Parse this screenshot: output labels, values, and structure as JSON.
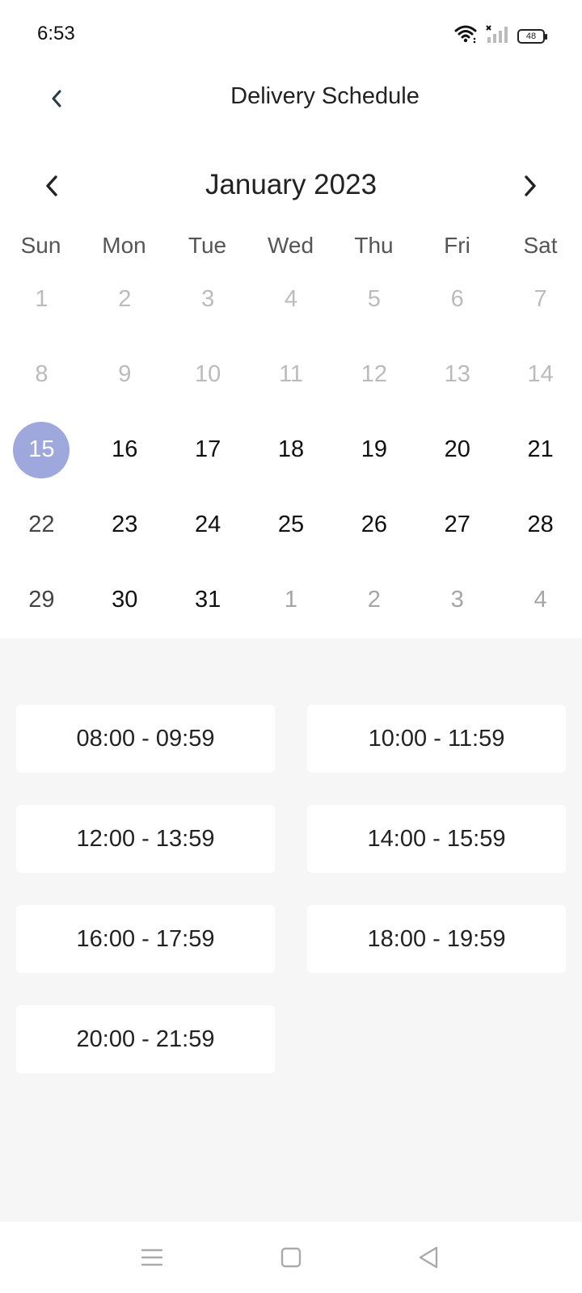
{
  "status_bar": {
    "time": "6:53",
    "battery": "48",
    "icons": [
      "wifi-icon",
      "no-signal-icon",
      "battery-icon"
    ]
  },
  "header": {
    "title": "Delivery Schedule",
    "back_icon": "chevron-left-icon"
  },
  "calendar": {
    "month_label": "January 2023",
    "prev_icon": "chevron-left-icon",
    "next_icon": "chevron-right-icon",
    "weekdays": [
      "Sun",
      "Mon",
      "Tue",
      "Wed",
      "Thu",
      "Fri",
      "Sat"
    ],
    "weeks": [
      [
        "1",
        "2",
        "3",
        "4",
        "5",
        "6",
        "7"
      ],
      [
        "8",
        "9",
        "10",
        "11",
        "12",
        "13",
        "14"
      ],
      [
        "15",
        "16",
        "17",
        "18",
        "19",
        "20",
        "21"
      ],
      [
        "22",
        "23",
        "24",
        "25",
        "26",
        "27",
        "28"
      ],
      [
        "29",
        "30",
        "31",
        "1",
        "2",
        "3",
        "4"
      ]
    ],
    "selected_day": "15"
  },
  "time_slots": [
    "08:00 - 09:59",
    "10:00 - 11:59",
    "12:00 - 13:59",
    "14:00 - 15:59",
    "16:00 - 17:59",
    "18:00 - 19:59",
    "20:00 - 21:59"
  ],
  "navigation": {
    "icons": [
      "menu-icon",
      "home-square-icon",
      "back-triangle-icon"
    ]
  },
  "colors": {
    "selected_day": "#9ea8dc",
    "slots_background": "#f6f6f6"
  }
}
